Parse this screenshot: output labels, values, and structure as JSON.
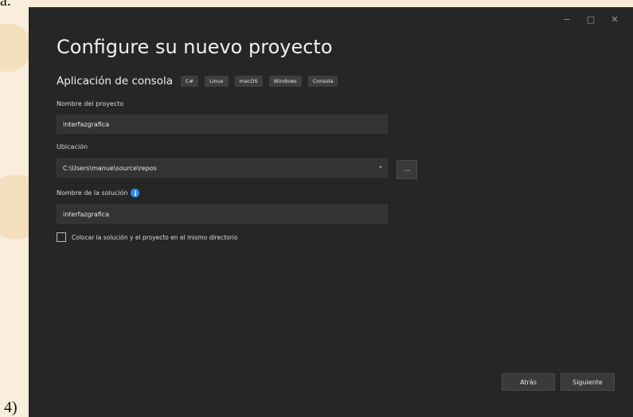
{
  "page_fragments": {
    "top_text": "a.",
    "bottom_text": "4)"
  },
  "window": {
    "controls": {
      "minimize": "−",
      "maximize": "□",
      "close": "✕"
    },
    "title": "Configure su nuevo proyecto",
    "template": {
      "name": "Aplicación de consola",
      "tags": [
        "C#",
        "Linux",
        "macOS",
        "Windows",
        "Consola"
      ]
    },
    "project_name": {
      "label": "Nombre del proyecto",
      "value": "interfazgrafica"
    },
    "location": {
      "label": "Ubicación",
      "value": "C:\\Users\\manue\\source\\repos",
      "browse_label": "..."
    },
    "solution_name": {
      "label": "Nombre de la solución",
      "info_glyph": "i",
      "value": "interfazgrafica"
    },
    "same_directory": {
      "label": "Colocar la solución y el proyecto en el mismo directorio",
      "checked": false
    },
    "footer": {
      "back_label": "Atrás",
      "next_label": "Siguiente"
    },
    "colors": {
      "window_bg": "#262626",
      "field_bg": "#333333",
      "info_icon": "#2f8de8"
    }
  }
}
